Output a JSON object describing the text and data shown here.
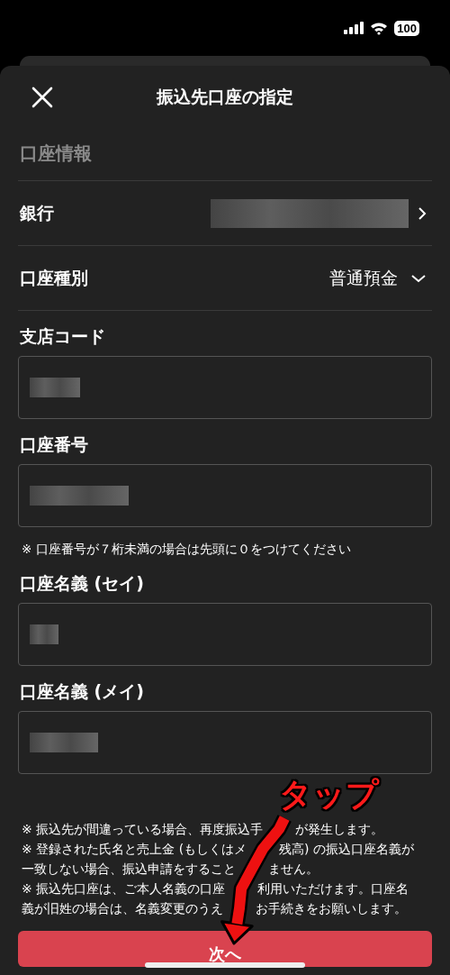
{
  "status_bar": {
    "battery": "100"
  },
  "header": {
    "title": "振込先口座の指定"
  },
  "section_title": "口座情報",
  "rows": [
    {
      "kind": "link",
      "label": "銀行",
      "value_redacted": true
    },
    {
      "kind": "select",
      "label": "口座種別",
      "value": "普通預金"
    }
  ],
  "fields": [
    {
      "label": "支店コード",
      "value_redacted": true
    },
    {
      "label": "口座番号",
      "value_redacted": true,
      "note": "※ 口座番号が７桁未満の場合は先頭に０をつけてください"
    },
    {
      "label": "口座名義 (セイ)",
      "value_redacted": true
    },
    {
      "label": "口座名義 (メイ)",
      "value_redacted": true
    }
  ],
  "note_lines": [
    [
      "※ 振込先が間違っている場合、再度振込手",
      "が発生します。"
    ],
    [
      "※ 登録された氏名と売上金 (もしくはメ",
      "残高) の振込口座名義が"
    ],
    [
      "一致しない場合、振込申請をすること",
      "ません。"
    ],
    [
      "※ 振込先口座は、ご本人名義の口座",
      "利用いただけます。口座名"
    ],
    [
      "義が旧姓の場合は、名義変更のうえ",
      "お手続きをお願いします。"
    ]
  ],
  "next_button": "次へ",
  "annotation": {
    "text": "タップ"
  }
}
